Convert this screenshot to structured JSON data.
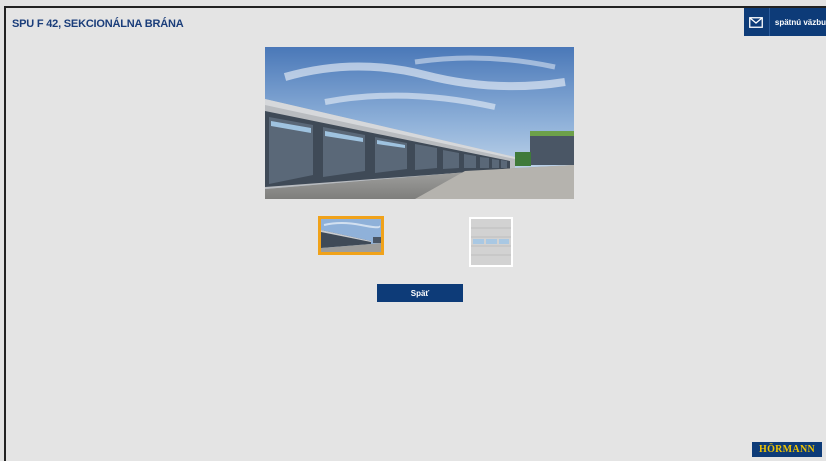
{
  "header": {
    "title": "SPU F 42, SEKCIONÁLNA BRÁNA",
    "feedback_label": "spätnú väzbu"
  },
  "icons": {
    "feedback": "mail-icon"
  },
  "gallery": {
    "selected_index": 0
  },
  "actions": {
    "back_label": "Späť"
  },
  "brand": {
    "logo_text": "HÖRMANN"
  },
  "colors": {
    "accent": "#0d3b78",
    "selected_border": "#f0a21a",
    "logo_text": "#f0c400"
  }
}
